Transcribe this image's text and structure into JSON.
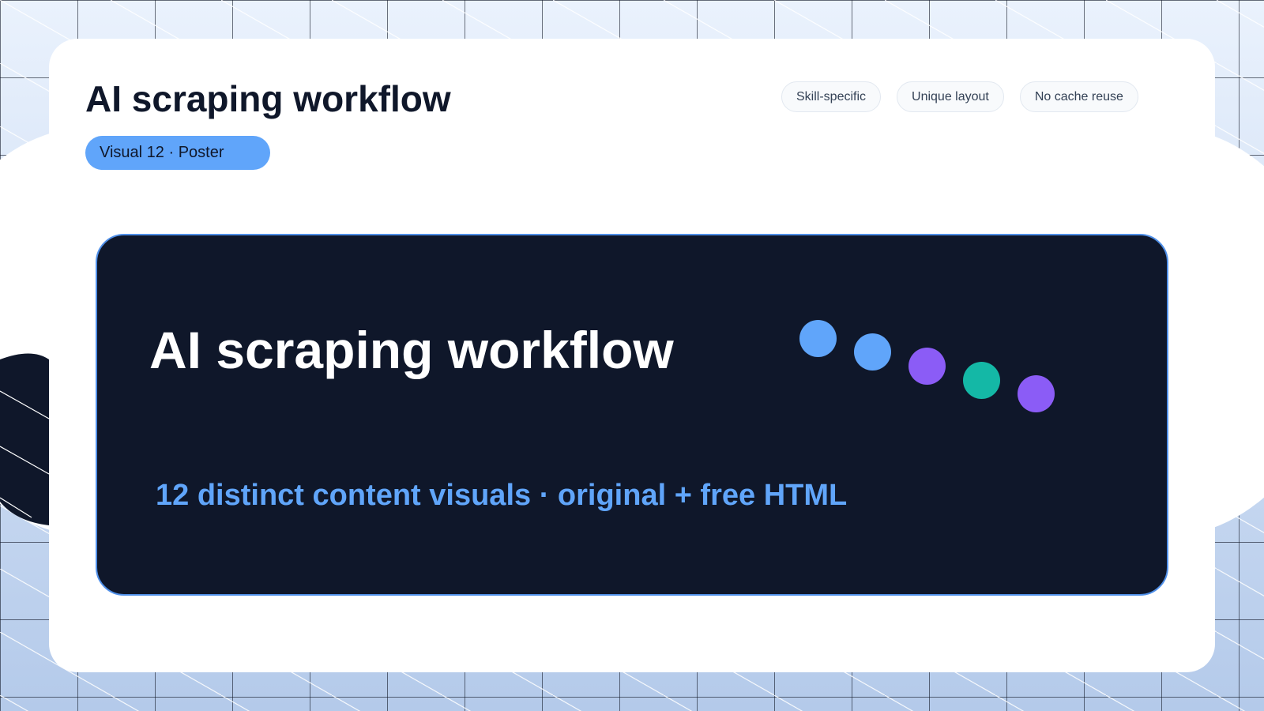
{
  "header": {
    "title": "AI scraping workflow",
    "visual_label": "Visual 12 · Poster",
    "tags": [
      "Skill-specific",
      "Unique layout",
      "No cache reuse"
    ]
  },
  "poster": {
    "title": "AI scraping workflow",
    "subtitle": "12 distinct content visuals · original + free HTML",
    "dot_colors": [
      "#60a5fa",
      "#60a5fa",
      "#8b5cf6",
      "#14b8a6",
      "#8b5cf6"
    ]
  },
  "colors": {
    "accent_blue": "#60a5fa",
    "accent_purple": "#8b5cf6",
    "accent_teal": "#14b8a6",
    "poster_bg": "#0f172a",
    "poster_border": "#4f8fe8",
    "card_bg": "#ffffff"
  }
}
